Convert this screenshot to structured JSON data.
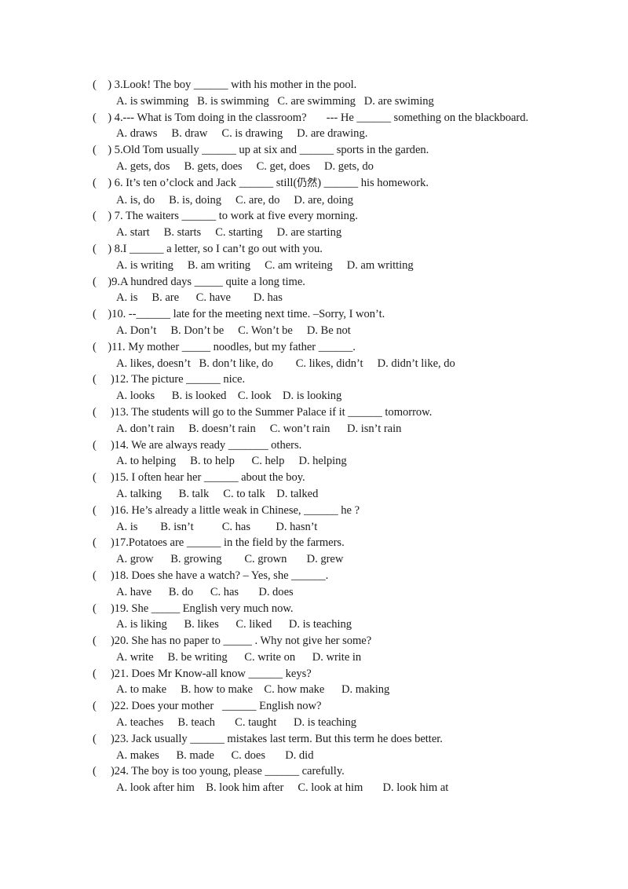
{
  "document": {
    "type": "worksheet",
    "subject": "English grammar multiple choice",
    "page_background": "#ffffff",
    "text_color": "#1b1b1b"
  },
  "questions": [
    {
      "marker": "(    ) 3.",
      "stem": "Look! The boy ______ with his mother in the pool.",
      "question_line": "(    ) 3.Look! The boy ______ with his mother in the pool.",
      "options_line": "A. is swimming   B. is swimming   C. are swimming   D. are swiming",
      "options": [
        "A. is swimming",
        "B. is swimming",
        "C. are swimming",
        "D. are swiming"
      ]
    },
    {
      "marker": "(    ) 4.",
      "stem": "--- What is Tom doing in the classroom?       --- He ______ something on the blackboard.",
      "question_line": "(    ) 4.--- What is Tom doing in the classroom?       --- He ______ something on the blackboard.",
      "options_line": "A. draws     B. draw     C. is drawing     D. are drawing.",
      "options": [
        "A. draws",
        "B. draw",
        "C. is drawing",
        "D. are drawing."
      ]
    },
    {
      "marker": "(    ) 5.",
      "stem": "Old Tom usually ______ up at six and ______ sports in the garden.",
      "question_line": "(    ) 5.Old Tom usually ______ up at six and ______ sports in the garden.",
      "options_line": "A. gets, dos     B. gets, does     C. get, does     D. gets, do",
      "options": [
        "A. gets, dos",
        "B. gets, does",
        "C. get, does",
        "D. gets, do"
      ]
    },
    {
      "marker": "(    ) 6.",
      "stem": "It's ten o'clock and Jack ______ still(仍然) ______ his homework.",
      "question_line_pre": "(    ) 6. It’s ten o’clock and Jack ______ still(",
      "question_line_cjk": "仍然",
      "question_line_post": ") ______ his homework.",
      "options_line": "A. is, do     B. is, doing     C. are, do     D. are, doing",
      "options": [
        "A. is, do",
        "B. is, doing",
        "C. are, do",
        "D. are, doing"
      ]
    },
    {
      "marker": "(    ) 7.",
      "stem": "The waiters ______ to work at five every morning.",
      "question_line": "(    ) 7. The waiters ______ to work at five every morning.",
      "options_line": "A. start     B. starts     C. starting     D. are starting",
      "options": [
        "A. start",
        "B. starts",
        "C. starting",
        "D. are starting"
      ]
    },
    {
      "marker": "(    ) 8.",
      "stem": "I ______ a letter, so I can't go out with you.",
      "question_line": "(    ) 8.I ______ a letter, so I can’t go out with you.",
      "options_line": "A. is writing     B. am writing     C. am writeing     D. am writting",
      "options": [
        "A. is writing",
        "B. am writing",
        "C. am writeing",
        "D. am writting"
      ]
    },
    {
      "marker": "(    )9.",
      "stem": "A hundred days _____ quite a long time.",
      "question_line": "(    )9.A hundred days _____ quite a long time.",
      "options_line": "A. is     B. are      C. have        D. has",
      "options": [
        "A. is",
        "B. are",
        "C. have",
        "D. has"
      ]
    },
    {
      "marker": "(    )10.",
      "stem": "--______ late for the meeting next time. –Sorry, I won't.",
      "question_line": "(    )10. --______ late for the meeting next time. –Sorry, I won’t.",
      "options_line": "A. Don’t     B. Don’t be     C. Won’t be     D. Be not",
      "options": [
        "A. Don’t",
        "B. Don’t be",
        "C. Won’t be",
        "D. Be not"
      ]
    },
    {
      "marker": "(    )11.",
      "stem": "My mother _____ noodles, but my father ______.",
      "question_line": "(    )11. My mother _____ noodles, but my father ______.",
      "options_line": "A. likes, doesn’t   B. don’t like, do        C. likes, didn’t     D. didn’t like, do",
      "options": [
        "A. likes, doesn’t",
        "B. don’t like, do",
        "C. likes, didn’t",
        "D. didn’t like, do"
      ]
    },
    {
      "marker": "(     )12.",
      "stem": "The picture ______ nice.",
      "question_line": "(     )12. The picture ______ nice.",
      "options_line": "A. looks      B. is looked    C. look    D. is looking",
      "options": [
        "A. looks",
        "B. is looked",
        "C. look",
        "D. is looking"
      ]
    },
    {
      "marker": "(     )13.",
      "stem": "The students will go to the Summer Palace if it ______ tomorrow.",
      "question_line": "(     )13. The students will go to the Summer Palace if it ______ tomorrow.",
      "options_line": "A. don’t rain     B. doesn’t rain     C. won’t rain      D. isn’t rain",
      "options": [
        "A. don’t rain",
        "B. doesn’t rain",
        "C. won’t rain",
        "D. isn’t rain"
      ]
    },
    {
      "marker": "(     )14.",
      "stem": "We are always ready _______ others.",
      "question_line": "(     )14. We are always ready _______ others.",
      "options_line": "A. to helping     B. to help      C. help     D. helping",
      "options": [
        "A. to helping",
        "B. to help",
        "C. help",
        "D. helping"
      ]
    },
    {
      "marker": "(     )15.",
      "stem": "I often hear her ______ about the boy.",
      "question_line": "(     )15. I often hear her ______ about the boy.",
      "options_line": "A. talking      B. talk     C. to talk    D. talked",
      "options": [
        "A. talking",
        "B. talk",
        "C. to talk",
        "D. talked"
      ]
    },
    {
      "marker": "(     )16.",
      "stem": "He's already a little weak in Chinese, ______ he ?",
      "question_line": "(     )16. He’s already a little weak in Chinese, ______ he ?",
      "options_line": "A. is        B. isn’t          C. has         D. hasn’t",
      "options": [
        "A. is",
        "B. isn’t",
        "C. has",
        "D. hasn’t"
      ]
    },
    {
      "marker": "(     )17.",
      "stem": "Potatoes are ______ in the field by the farmers.",
      "question_line": "(     )17.Potatoes are ______ in the field by the farmers.",
      "options_line": "A. grow      B. growing        C. grown       D. grew",
      "options": [
        "A. grow",
        "B. growing",
        "C. grown",
        "D. grew"
      ]
    },
    {
      "marker": "(     )18.",
      "stem": "Does she have a watch? – Yes, she ______.",
      "question_line": "(     )18. Does she have a watch? – Yes, she ______.",
      "options_line": "A. have      B. do      C. has       D. does",
      "options": [
        "A. have",
        "B. do",
        "C. has",
        "D. does"
      ]
    },
    {
      "marker": "(     )19.",
      "stem": "She _____ English very much now.",
      "question_line": "(     )19. She _____ English very much now.",
      "options_line": "A. is liking      B. likes      C. liked      D. is teaching",
      "options": [
        "A. is liking",
        "B. likes",
        "C. liked",
        "D. is teaching"
      ]
    },
    {
      "marker": "(     )20.",
      "stem": "She has no paper to _____ . Why not give her some?",
      "question_line": "(     )20. She has no paper to _____ . Why not give her some?",
      "options_line": "A. write     B. be writing      C. write on      D. write in",
      "options": [
        "A. write",
        "B. be writing",
        "C. write on",
        "D. write in"
      ]
    },
    {
      "marker": "(     )21.",
      "stem": "Does Mr Know-all know ______ keys?",
      "question_line": "(     )21. Does Mr Know-all know ______ keys?",
      "options_line": "A. to make     B. how to make    C. how make      D. making",
      "options": [
        "A. to make",
        "B. how to make",
        "C. how make",
        "D. making"
      ]
    },
    {
      "marker": "(     )22.",
      "stem": "Does your mother  ______ English now?",
      "question_line": "(     )22. Does your mother   ______ English now?",
      "options_line": "A. teaches     B. teach       C. taught      D. is teaching",
      "options": [
        "A. teaches",
        "B. teach",
        "C. taught",
        "D. is teaching"
      ]
    },
    {
      "marker": "(     )23.",
      "stem": "Jack usually ______ mistakes last term. But this term he does better.",
      "question_line": "(     )23. Jack usually ______ mistakes last term. But this term he does better.",
      "options_line": "A. makes      B. made      C. does       D. did",
      "options": [
        "A. makes",
        "B. made",
        "C. does",
        "D. did"
      ]
    },
    {
      "marker": "(     )24.",
      "stem": "The boy is too young, please ______ carefully.",
      "question_line": "(     )24. The boy is too young, please ______ carefully.",
      "options_line": "A. look after him    B. look him after     C. look at him       D. look him at",
      "options": [
        "A. look after him",
        "B. look him after",
        "C. look at him",
        "D. look him at"
      ]
    }
  ]
}
